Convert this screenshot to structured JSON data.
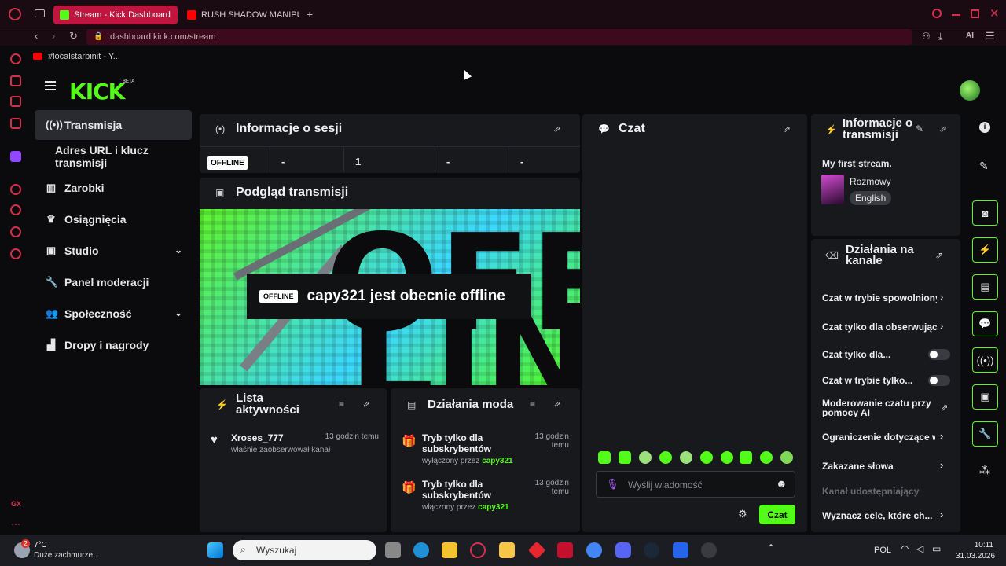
{
  "browser": {
    "tabs": [
      {
        "label": "Stream - Kick Dashboard",
        "active": true
      },
      {
        "label": "RUSH SHADOW MANIPUL",
        "active": false
      }
    ],
    "new_tab": "+",
    "url": "dashboard.kick.com/stream",
    "bookmark": "#localstarbinit - Y...",
    "ai_label": "AI"
  },
  "header": {
    "logo": "KICK",
    "beta": "BETA"
  },
  "sidebar": {
    "items": [
      {
        "label": "Transmisja",
        "icon": "broadcast-icon",
        "selected": true
      },
      {
        "label": "Adres URL i klucz transmisji",
        "icon": "",
        "selected": false
      },
      {
        "label": "Zarobki",
        "icon": "chart-icon",
        "selected": false
      },
      {
        "label": "Osiągnięcia",
        "icon": "trophy-icon",
        "selected": false
      },
      {
        "label": "Studio",
        "icon": "studio-icon",
        "selected": false,
        "expandable": true
      },
      {
        "label": "Panel moderacji",
        "icon": "wrench-icon",
        "selected": false
      },
      {
        "label": "Społeczność",
        "icon": "community-icon",
        "selected": false,
        "expandable": true
      },
      {
        "label": "Dropy i nagrody",
        "icon": "drops-icon",
        "selected": false
      }
    ]
  },
  "session": {
    "title": "Informacje o sesji",
    "badge": "OFFLINE",
    "stats": [
      "-",
      "1",
      "-",
      "-"
    ]
  },
  "preview": {
    "title": "Podgląd transmisji",
    "badge": "OFFLINE",
    "message": "capy321 jest obecnie offline"
  },
  "activity": {
    "title": "Lista aktywności",
    "items": [
      {
        "user": "Xroses_777",
        "text": "właśnie zaobserwował kanał",
        "time": "13 godzin temu"
      }
    ]
  },
  "mod_actions": {
    "title": "Działania moda",
    "items": [
      {
        "title": "Tryb tylko dla subskrybentów",
        "status": "wyłączony przez",
        "user": "capy321",
        "time": "13 godzin temu"
      },
      {
        "title": "Tryb tylko dla subskrybentów",
        "status": "włączony przez",
        "user": "capy321",
        "time": "13 godzin temu"
      }
    ]
  },
  "chat": {
    "title": "Czat",
    "placeholder": "Wyślij wiadomość",
    "send_label": "Czat"
  },
  "stream_info": {
    "title": "Informacje o transmisji",
    "stream_title": "My first stream.",
    "category": "Rozmowy",
    "language": "English"
  },
  "channel_actions": {
    "title": "Działania na kanale",
    "items": [
      {
        "label": "Czat w trybie spowolnionym",
        "control": "chevron"
      },
      {
        "label": "Czat tylko dla obserwujących",
        "control": "chevron"
      },
      {
        "label": "Czat tylko dla...",
        "control": "toggle"
      },
      {
        "label": "Czat w trybie tylko...",
        "control": "toggle"
      },
      {
        "label": "Moderowanie czatu przy pomocy AI",
        "control": "external"
      },
      {
        "label": "Ograniczenie dotyczące wieku",
        "control": "chevron"
      },
      {
        "label": "Zakazane słowa",
        "control": "chevron"
      },
      {
        "label": "Kanał udostępniający",
        "control": "disabled"
      },
      {
        "label": "Wyznacz cele, które ch...",
        "control": "chevron"
      }
    ]
  },
  "taskbar": {
    "weather_temp": "7°C",
    "weather_text": "Duże zachmurze...",
    "weather_badge": "2",
    "search_placeholder": "Wyszukaj",
    "language": "POL",
    "time": "10:11",
    "date": "31.03.2026"
  },
  "colors": {
    "brand": "#53fc18",
    "browser_accent": "#c0153f"
  }
}
